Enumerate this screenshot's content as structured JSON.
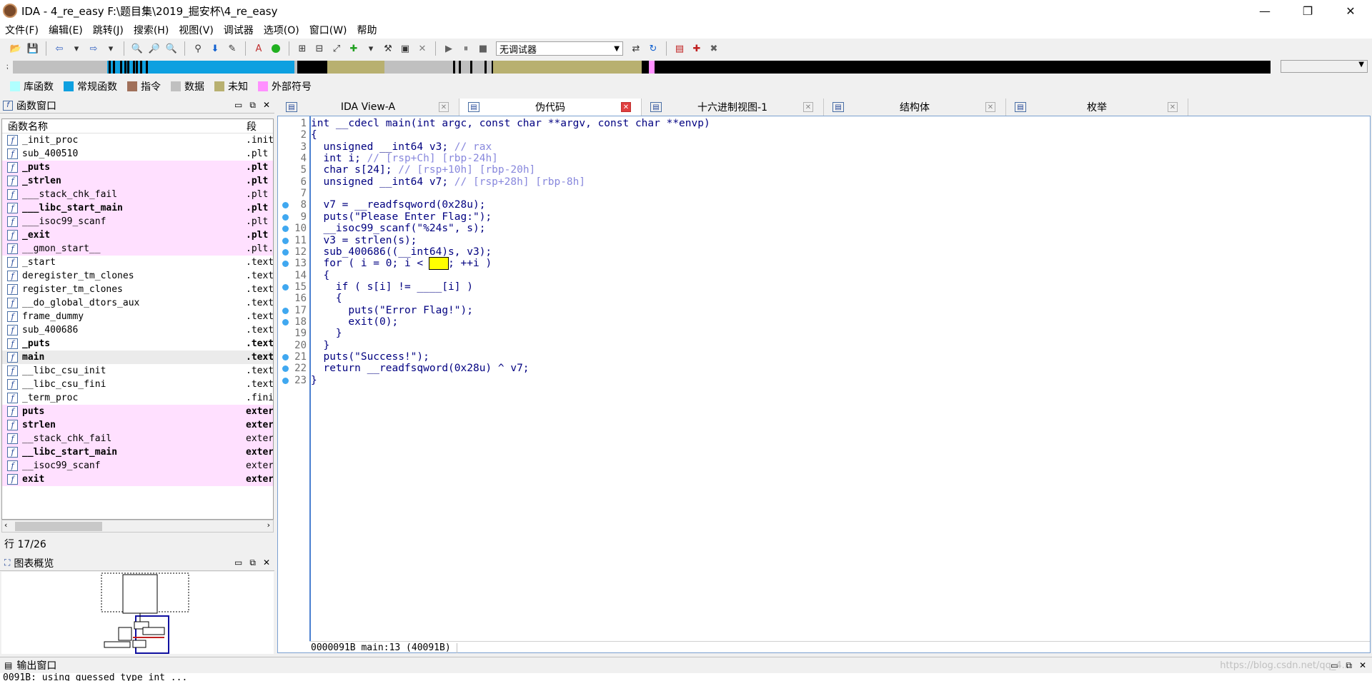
{
  "window": {
    "title": "IDA - 4_re_easy F:\\题目集\\2019_掘安杯\\4_re_easy",
    "min": "—",
    "max": "❐",
    "close": "✕"
  },
  "menu": [
    "文件(F)",
    "编辑(E)",
    "跳转(J)",
    "搜索(H)",
    "视图(V)",
    "调试器",
    "选项(O)",
    "窗口(W)",
    "帮助"
  ],
  "toolbar": {
    "debugger": "无调试器"
  },
  "legend": [
    {
      "label": "库函数",
      "color": "#b0ffff"
    },
    {
      "label": "常规函数",
      "color": "#0ea0e0"
    },
    {
      "label": "指令",
      "color": "#a0705a"
    },
    {
      "label": "数据",
      "color": "#c0c0c0"
    },
    {
      "label": "未知",
      "color": "#b8b070"
    },
    {
      "label": "外部符号",
      "color": "#ff90ff"
    }
  ],
  "func_panel": {
    "title": "函数窗口",
    "col_name": "函数名称",
    "col_seg": "段"
  },
  "functions": [
    {
      "name": "_init_proc",
      "seg": ".init",
      "style": "normal"
    },
    {
      "name": "sub_400510",
      "seg": ".plt",
      "style": "normal"
    },
    {
      "name": "_puts",
      "seg": ".plt",
      "style": "pinkbold"
    },
    {
      "name": "_strlen",
      "seg": ".plt",
      "style": "pinkbold"
    },
    {
      "name": "___stack_chk_fail",
      "seg": ".plt",
      "style": "pink"
    },
    {
      "name": "___libc_start_main",
      "seg": ".plt",
      "style": "pinkbold"
    },
    {
      "name": "___isoc99_scanf",
      "seg": ".plt",
      "style": "pink"
    },
    {
      "name": "_exit",
      "seg": ".plt",
      "style": "pinkbold"
    },
    {
      "name": "__gmon_start__",
      "seg": ".plt.",
      "style": "pink"
    },
    {
      "name": "_start",
      "seg": ".text",
      "style": "normal"
    },
    {
      "name": "deregister_tm_clones",
      "seg": ".text",
      "style": "normal"
    },
    {
      "name": "register_tm_clones",
      "seg": ".text",
      "style": "normal"
    },
    {
      "name": "__do_global_dtors_aux",
      "seg": ".text",
      "style": "normal"
    },
    {
      "name": "frame_dummy",
      "seg": ".text",
      "style": "normal"
    },
    {
      "name": "sub_400686",
      "seg": ".text",
      "style": "normal"
    },
    {
      "name": "_puts",
      "seg": ".text",
      "style": "bold"
    },
    {
      "name": "main",
      "seg": ".text",
      "style": "selbold"
    },
    {
      "name": "__libc_csu_init",
      "seg": ".text",
      "style": "normal"
    },
    {
      "name": "__libc_csu_fini",
      "seg": ".text",
      "style": "normal"
    },
    {
      "name": "_term_proc",
      "seg": ".fini",
      "style": "normal"
    },
    {
      "name": "puts",
      "seg": "extern",
      "style": "pinkbold"
    },
    {
      "name": "strlen",
      "seg": "extern",
      "style": "pinkbold"
    },
    {
      "name": "__stack_chk_fail",
      "seg": "extern",
      "style": "pink"
    },
    {
      "name": "__libc_start_main",
      "seg": "extern",
      "style": "pinkbold"
    },
    {
      "name": "__isoc99_scanf",
      "seg": "extern",
      "style": "pink"
    },
    {
      "name": "exit",
      "seg": "extern",
      "style": "pinkbold"
    }
  ],
  "row_info": "行 17/26",
  "graph_panel": {
    "title": "图表概览"
  },
  "tabs": [
    {
      "label": "IDA View-A",
      "icon": "ida-view-icon",
      "active": false
    },
    {
      "label": "伪代码",
      "icon": "pseudocode-icon",
      "active": true
    },
    {
      "label": "十六进制视图-1",
      "icon": "hex-view-icon",
      "active": false
    },
    {
      "label": "结构体",
      "icon": "structures-icon",
      "active": false
    },
    {
      "label": "枚举",
      "icon": "enums-icon",
      "active": false
    }
  ],
  "code": [
    {
      "n": "1",
      "dot": false,
      "t": "int __cdecl main(int argc, const char **argv, const char **envp)"
    },
    {
      "n": "2",
      "dot": false,
      "t": "{"
    },
    {
      "n": "3",
      "dot": false,
      "t": "  unsigned __int64 v3; ",
      "c": "// rax"
    },
    {
      "n": "4",
      "dot": false,
      "t": "  int i; ",
      "c": "// [rsp+Ch] [rbp-24h]"
    },
    {
      "n": "5",
      "dot": false,
      "t": "  char s[24]; ",
      "c": "// [rsp+10h] [rbp-20h]"
    },
    {
      "n": "6",
      "dot": false,
      "t": "  unsigned __int64 v7; ",
      "c": "// [rsp+28h] [rbp-8h]"
    },
    {
      "n": "7",
      "dot": false,
      "t": ""
    },
    {
      "n": "8",
      "dot": true,
      "t": "  v7 = __readfsqword(0x28u);"
    },
    {
      "n": "9",
      "dot": true,
      "t": "  puts(\"Please Enter Flag:\");"
    },
    {
      "n": "10",
      "dot": true,
      "t": "  __isoc99_scanf(\"%24s\", s);"
    },
    {
      "n": "11",
      "dot": true,
      "t": "  v3 = strlen(s);"
    },
    {
      "n": "12",
      "dot": true,
      "t": "  sub_400686((__int64)s, v3);"
    },
    {
      "n": "13",
      "dot": true,
      "t": "  for ( i = 0; i < ",
      "box": "   ",
      "t2": "; ++i )"
    },
    {
      "n": "14",
      "dot": false,
      "t": "  {"
    },
    {
      "n": "15",
      "dot": true,
      "t": "    if ( s[i] != ____[i] )"
    },
    {
      "n": "16",
      "dot": false,
      "t": "    {"
    },
    {
      "n": "17",
      "dot": true,
      "t": "      puts(\"Error Flag!\");"
    },
    {
      "n": "18",
      "dot": true,
      "t": "      exit(0);"
    },
    {
      "n": "19",
      "dot": false,
      "t": "    }"
    },
    {
      "n": "20",
      "dot": false,
      "t": "  }"
    },
    {
      "n": "21",
      "dot": true,
      "t": "  puts(\"Success!\");"
    },
    {
      "n": "22",
      "dot": true,
      "t": "  return __readfsqword(0x28u) ^ v7;"
    },
    {
      "n": "23",
      "dot": true,
      "t": "}"
    }
  ],
  "code_status": "0000091B main:13 (40091B)",
  "output": {
    "title": "输出窗口",
    "text": "0091B: using guessed type int ..."
  },
  "watermark": "https://blog.csdn.net/qq_4..."
}
